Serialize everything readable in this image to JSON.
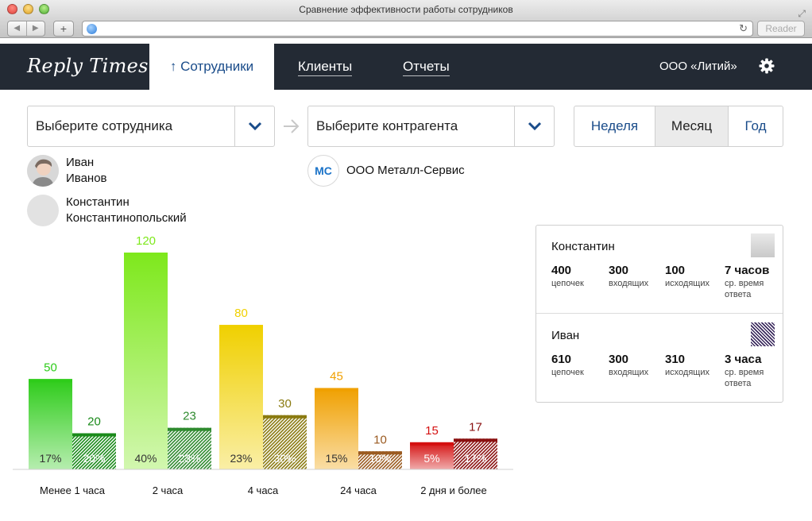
{
  "window": {
    "title": "Сравнение эффективности работы сотрудников",
    "reader_label": "Reader"
  },
  "header": {
    "logo": "Reply Times",
    "tabs": [
      {
        "label": "↑ Сотрудники",
        "active": true
      },
      {
        "label": "Клиенты",
        "active": false
      },
      {
        "label": "Отчеты",
        "active": false
      }
    ],
    "company": "ООО «Литий»"
  },
  "filters": {
    "employee_placeholder": "Выберите сотрудника",
    "contractor_placeholder": "Выберите контрагента",
    "periods": [
      "Неделя",
      "Месяц",
      "Год"
    ],
    "selected_period": "Месяц"
  },
  "people": [
    {
      "first": "Иван",
      "last": "Иванов"
    },
    {
      "first": "Константин",
      "last": "Константинопольский"
    }
  ],
  "contractor": {
    "badge": "MC",
    "name": "ООО Металл-Сервис"
  },
  "legend": [
    {
      "name": "Константин",
      "stats": [
        {
          "value": "400",
          "label": "цепочек"
        },
        {
          "value": "300",
          "label": "входящих"
        },
        {
          "value": "100",
          "label": "исходящих"
        },
        {
          "value": "7 часов",
          "label": "ср. время ответа"
        }
      ]
    },
    {
      "name": "Иван",
      "stats": [
        {
          "value": "610",
          "label": "цепочек"
        },
        {
          "value": "300",
          "label": "входящих"
        },
        {
          "value": "310",
          "label": "исходящих"
        },
        {
          "value": "3 часа",
          "label": "ср. время ответа"
        }
      ]
    }
  ],
  "colors": {
    "accent": "#1a4c8a",
    "header_bg": "#232a34",
    "groups": [
      "#2ecc1a",
      "#7ee81c",
      "#f0d000",
      "#f0a000",
      "#d41010"
    ],
    "dark": [
      "#1a8a1a",
      "#2e8a2e",
      "#8a7a10",
      "#9a5a20",
      "#8a1010"
    ]
  },
  "chart_data": {
    "type": "bar",
    "categories": [
      "Менее 1 часа",
      "2 часа",
      "4 часа",
      "24 часа",
      "2 дня и более"
    ],
    "series": [
      {
        "name": "Константин",
        "values": [
          50,
          120,
          80,
          45,
          15
        ],
        "percents": [
          "17%",
          "40%",
          "23%",
          "15%",
          "5%"
        ]
      },
      {
        "name": "Иван",
        "values": [
          20,
          23,
          30,
          10,
          17
        ],
        "percents": [
          "20%",
          "23%",
          "30%",
          "10%",
          "17%"
        ]
      }
    ],
    "ylim": [
      0,
      120
    ],
    "grid": false,
    "legend": "right"
  }
}
